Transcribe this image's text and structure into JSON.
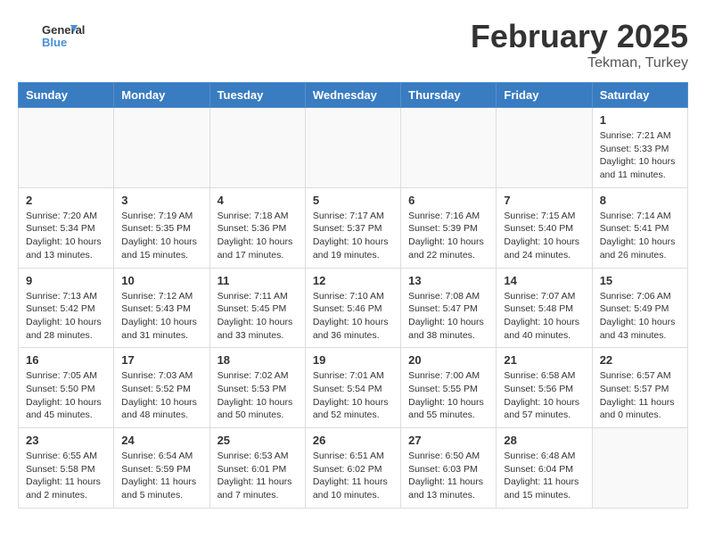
{
  "header": {
    "logo_general": "General",
    "logo_blue": "Blue",
    "month": "February 2025",
    "location": "Tekman, Turkey"
  },
  "weekdays": [
    "Sunday",
    "Monday",
    "Tuesday",
    "Wednesday",
    "Thursday",
    "Friday",
    "Saturday"
  ],
  "weeks": [
    [
      {
        "day": "",
        "info": ""
      },
      {
        "day": "",
        "info": ""
      },
      {
        "day": "",
        "info": ""
      },
      {
        "day": "",
        "info": ""
      },
      {
        "day": "",
        "info": ""
      },
      {
        "day": "",
        "info": ""
      },
      {
        "day": "1",
        "info": "Sunrise: 7:21 AM\nSunset: 5:33 PM\nDaylight: 10 hours and 11 minutes."
      }
    ],
    [
      {
        "day": "2",
        "info": "Sunrise: 7:20 AM\nSunset: 5:34 PM\nDaylight: 10 hours and 13 minutes."
      },
      {
        "day": "3",
        "info": "Sunrise: 7:19 AM\nSunset: 5:35 PM\nDaylight: 10 hours and 15 minutes."
      },
      {
        "day": "4",
        "info": "Sunrise: 7:18 AM\nSunset: 5:36 PM\nDaylight: 10 hours and 17 minutes."
      },
      {
        "day": "5",
        "info": "Sunrise: 7:17 AM\nSunset: 5:37 PM\nDaylight: 10 hours and 19 minutes."
      },
      {
        "day": "6",
        "info": "Sunrise: 7:16 AM\nSunset: 5:39 PM\nDaylight: 10 hours and 22 minutes."
      },
      {
        "day": "7",
        "info": "Sunrise: 7:15 AM\nSunset: 5:40 PM\nDaylight: 10 hours and 24 minutes."
      },
      {
        "day": "8",
        "info": "Sunrise: 7:14 AM\nSunset: 5:41 PM\nDaylight: 10 hours and 26 minutes."
      }
    ],
    [
      {
        "day": "9",
        "info": "Sunrise: 7:13 AM\nSunset: 5:42 PM\nDaylight: 10 hours and 28 minutes."
      },
      {
        "day": "10",
        "info": "Sunrise: 7:12 AM\nSunset: 5:43 PM\nDaylight: 10 hours and 31 minutes."
      },
      {
        "day": "11",
        "info": "Sunrise: 7:11 AM\nSunset: 5:45 PM\nDaylight: 10 hours and 33 minutes."
      },
      {
        "day": "12",
        "info": "Sunrise: 7:10 AM\nSunset: 5:46 PM\nDaylight: 10 hours and 36 minutes."
      },
      {
        "day": "13",
        "info": "Sunrise: 7:08 AM\nSunset: 5:47 PM\nDaylight: 10 hours and 38 minutes."
      },
      {
        "day": "14",
        "info": "Sunrise: 7:07 AM\nSunset: 5:48 PM\nDaylight: 10 hours and 40 minutes."
      },
      {
        "day": "15",
        "info": "Sunrise: 7:06 AM\nSunset: 5:49 PM\nDaylight: 10 hours and 43 minutes."
      }
    ],
    [
      {
        "day": "16",
        "info": "Sunrise: 7:05 AM\nSunset: 5:50 PM\nDaylight: 10 hours and 45 minutes."
      },
      {
        "day": "17",
        "info": "Sunrise: 7:03 AM\nSunset: 5:52 PM\nDaylight: 10 hours and 48 minutes."
      },
      {
        "day": "18",
        "info": "Sunrise: 7:02 AM\nSunset: 5:53 PM\nDaylight: 10 hours and 50 minutes."
      },
      {
        "day": "19",
        "info": "Sunrise: 7:01 AM\nSunset: 5:54 PM\nDaylight: 10 hours and 52 minutes."
      },
      {
        "day": "20",
        "info": "Sunrise: 7:00 AM\nSunset: 5:55 PM\nDaylight: 10 hours and 55 minutes."
      },
      {
        "day": "21",
        "info": "Sunrise: 6:58 AM\nSunset: 5:56 PM\nDaylight: 10 hours and 57 minutes."
      },
      {
        "day": "22",
        "info": "Sunrise: 6:57 AM\nSunset: 5:57 PM\nDaylight: 11 hours and 0 minutes."
      }
    ],
    [
      {
        "day": "23",
        "info": "Sunrise: 6:55 AM\nSunset: 5:58 PM\nDaylight: 11 hours and 2 minutes."
      },
      {
        "day": "24",
        "info": "Sunrise: 6:54 AM\nSunset: 5:59 PM\nDaylight: 11 hours and 5 minutes."
      },
      {
        "day": "25",
        "info": "Sunrise: 6:53 AM\nSunset: 6:01 PM\nDaylight: 11 hours and 7 minutes."
      },
      {
        "day": "26",
        "info": "Sunrise: 6:51 AM\nSunset: 6:02 PM\nDaylight: 11 hours and 10 minutes."
      },
      {
        "day": "27",
        "info": "Sunrise: 6:50 AM\nSunset: 6:03 PM\nDaylight: 11 hours and 13 minutes."
      },
      {
        "day": "28",
        "info": "Sunrise: 6:48 AM\nSunset: 6:04 PM\nDaylight: 11 hours and 15 minutes."
      },
      {
        "day": "",
        "info": ""
      }
    ]
  ]
}
